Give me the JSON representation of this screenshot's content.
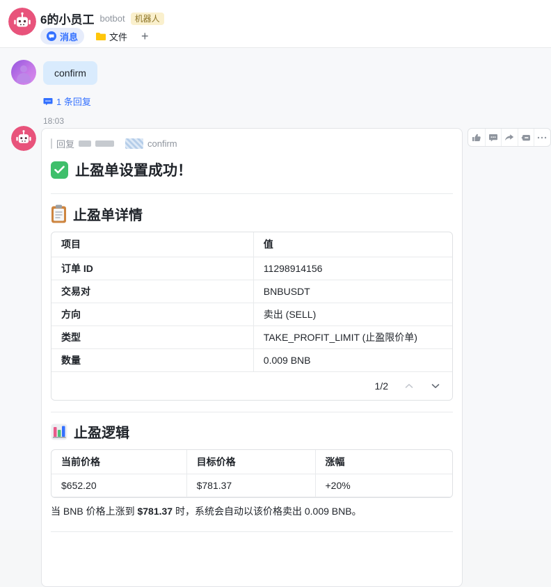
{
  "header": {
    "title": "6的小员工",
    "subtitle": "botbot",
    "badge": "机器人",
    "tabs": {
      "messages": "消息",
      "files": "文件",
      "add": "+"
    }
  },
  "user_message": {
    "text": "confirm",
    "reply_count_label": "1 条回复"
  },
  "bot_message": {
    "timestamp": "18:03",
    "quote": {
      "prefix": "回复",
      "quoted_text": "confirm"
    },
    "title": "止盈单设置成功！",
    "details": {
      "heading": "止盈单详情",
      "table": {
        "columns": [
          "项目",
          "值"
        ],
        "rows": [
          [
            "订单 ID",
            "11298914156"
          ],
          [
            "交易对",
            "BNBUSDT"
          ],
          [
            "方向",
            "卖出 (SELL)"
          ],
          [
            "类型",
            "TAKE_PROFIT_LIMIT (止盈限价单)"
          ],
          [
            "数量",
            "0.009 BNB"
          ]
        ]
      },
      "pagination": "1/2"
    },
    "logic": {
      "heading": "止盈逻辑",
      "table": {
        "columns": [
          "当前价格",
          "目标价格",
          "涨幅"
        ],
        "rows": [
          [
            "$652.20",
            "$781.37",
            "+20%"
          ]
        ]
      },
      "note": {
        "before": "当 BNB 价格上涨到 ",
        "bold": "$781.37",
        "after": " 时，系统会自动以该价格卖出 0.009 BNB。"
      }
    }
  },
  "icons": {
    "title_icon": "green-check-square",
    "details_icon": "clipboard",
    "logic_icon": "bar-chart",
    "actions": [
      "thumbs-up",
      "comment",
      "forward",
      "topic",
      "more"
    ]
  },
  "colors": {
    "brand_blue": "#3370ff",
    "avatar_pink": "#e8537b",
    "bubble_blue": "#d9ebfd",
    "check_green": "#3fbf6b",
    "badge_bg": "#faf0cd",
    "badge_text": "#8d7426",
    "text_primary": "#1f2329",
    "text_secondary": "#8f959e"
  }
}
